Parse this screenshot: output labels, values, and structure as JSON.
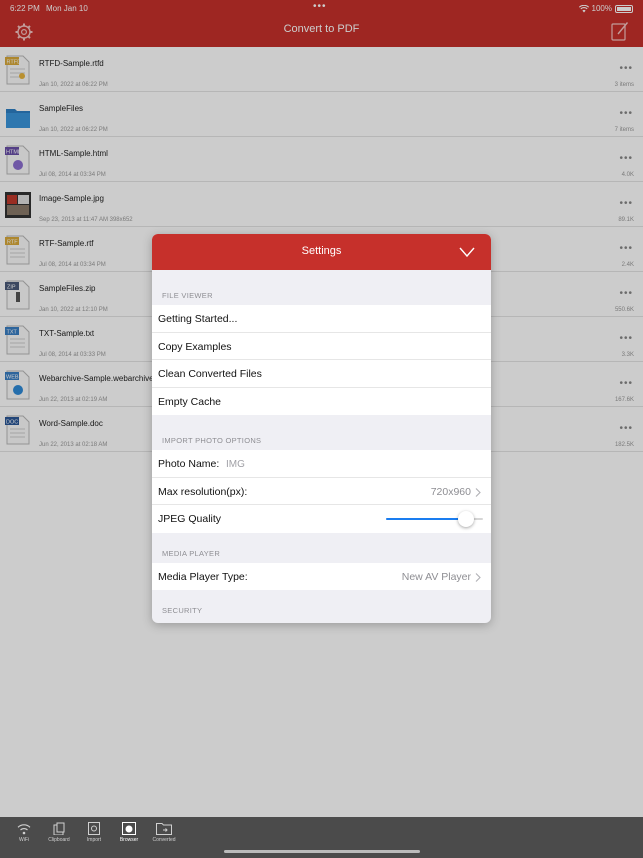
{
  "status": {
    "time": "6:22 PM",
    "date": "Mon Jan 10",
    "battery": "100%"
  },
  "nav": {
    "title": "Convert to PDF"
  },
  "files": [
    {
      "name": "RTFD-Sample.rtfd",
      "date": "Jan 10, 2022 at 06:22 PM",
      "size": "3 items",
      "type": "RTFD"
    },
    {
      "name": "SampleFiles",
      "date": "Jan 10, 2022 at 06:22 PM",
      "size": "7 items",
      "type": "folder"
    },
    {
      "name": "HTML-Sample.html",
      "date": "Jul 08, 2014 at 03:34 PM",
      "size": "4.0K",
      "type": "HTML"
    },
    {
      "name": "Image-Sample.jpg",
      "date": "Sep 23, 2013 at 11:47 AM  398x652",
      "size": "89.1K",
      "type": "image"
    },
    {
      "name": "RTF-Sample.rtf",
      "date": "Jul 08, 2014 at 03:34 PM",
      "size": "2.4K",
      "type": "RTF"
    },
    {
      "name": "SampleFiles.zip",
      "date": "Jan 10, 2022 at 12:10 PM",
      "size": "550.6K",
      "type": "ZIP"
    },
    {
      "name": "TXT-Sample.txt",
      "date": "Jul 08, 2014 at 03:33 PM",
      "size": "3.3K",
      "type": "TXT"
    },
    {
      "name": "Webarchive-Sample.webarchive",
      "date": "Jun 22, 2013 at 02:19 AM",
      "size": "167.6K",
      "type": "WEB"
    },
    {
      "name": "Word-Sample.doc",
      "date": "Jun 22, 2013 at 02:18 AM",
      "size": "182.5K",
      "type": "DOC"
    }
  ],
  "tabs": [
    "WiFi",
    "Clipboard",
    "Import",
    "Browser",
    "Converted"
  ],
  "modal": {
    "title": "Settings",
    "file_viewer": {
      "header": "FILE VIEWER",
      "items": [
        "Getting Started...",
        "Copy Examples",
        "Clean Converted Files",
        "Empty Cache"
      ]
    },
    "import_photo": {
      "header": "IMPORT PHOTO OPTIONS",
      "photo_name_label": "Photo Name:",
      "photo_name_placeholder": "IMG",
      "max_res_label": "Max resolution(px):",
      "max_res_value": "720x960",
      "jpeg_label": "JPEG Quality",
      "jpeg_quality": 0.82
    },
    "media_player": {
      "header": "MEDIA PLAYER",
      "type_label": "Media Player Type:",
      "type_value": "New AV Player"
    },
    "security": {
      "header": "SECURITY"
    }
  },
  "colors": {
    "brand_red": "#c6302b",
    "slider_blue": "#1a7df0"
  }
}
